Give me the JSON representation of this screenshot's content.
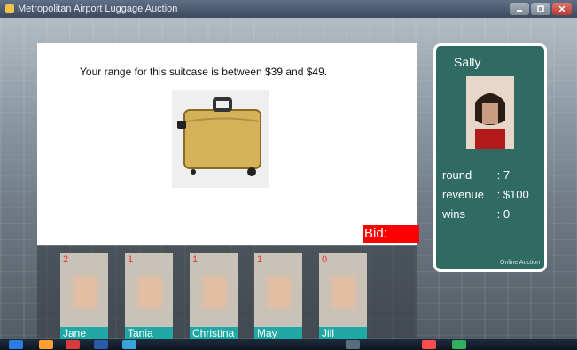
{
  "window": {
    "title": "Metropolitan Airport Luggage Auction"
  },
  "auction": {
    "range_text": "Your range for this suitcase is between $39 and $49.",
    "bid_label": "Bid:"
  },
  "profile": {
    "name": "Sally",
    "stats": [
      {
        "label": "round",
        "value": ": 7"
      },
      {
        "label": "revenue",
        "value": ": $100"
      },
      {
        "label": "wins",
        "value": ": 0"
      }
    ],
    "footer": "Online Auction"
  },
  "players": [
    {
      "name": "Jane",
      "count": "2"
    },
    {
      "name": "Tania",
      "count": "1"
    },
    {
      "name": "Christina",
      "count": "1"
    },
    {
      "name": "May",
      "count": "1"
    },
    {
      "name": "Jill",
      "count": "0"
    }
  ]
}
